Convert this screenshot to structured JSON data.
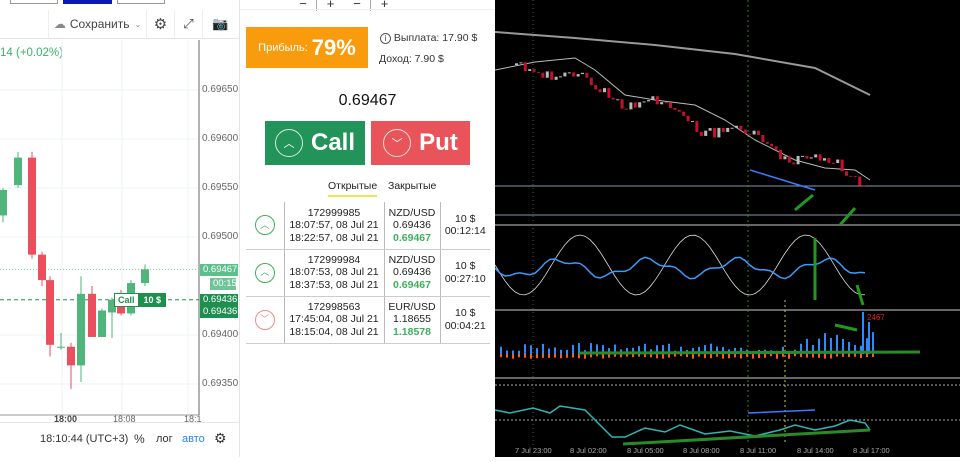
{
  "left_chart": {
    "toolbar": {
      "save_label": "Сохранить"
    },
    "change_text": "14 (+0.02%)",
    "price_ticks": [
      "0.69650",
      "0.69600",
      "0.69550",
      "0.69500",
      "0.69400",
      "0.69350"
    ],
    "time_ticks": [
      "18:00",
      "18:08",
      "18:1"
    ],
    "current_price_tag": "0.69467",
    "countdown_tag": "00:15",
    "open_price_tags": [
      "0.69436",
      "0.69436"
    ],
    "trade_marker": {
      "label": "Call",
      "amount": "10 $"
    },
    "candles": [
      [
        0.69522,
        0.6955,
        0.69515,
        0.69548
      ],
      [
        0.69553,
        0.69587,
        0.6955,
        0.69581
      ],
      [
        0.69581,
        0.69587,
        0.69478,
        0.69482
      ],
      [
        0.69482,
        0.69485,
        0.6945,
        0.69456
      ],
      [
        0.69456,
        0.6946,
        0.69378,
        0.6939
      ],
      [
        0.69388,
        0.69402,
        0.69385,
        0.69388
      ],
      [
        0.69388,
        0.69392,
        0.69345,
        0.69369
      ],
      [
        0.69369,
        0.6946,
        0.69352,
        0.69442
      ],
      [
        0.69442,
        0.6945,
        0.69398,
        0.69398
      ],
      [
        0.69398,
        0.69427,
        0.69398,
        0.69425
      ],
      [
        0.69423,
        0.69438,
        0.69397,
        0.69436
      ],
      [
        0.69436,
        0.69446,
        0.6942,
        0.69422
      ],
      [
        0.69422,
        0.69456,
        0.6942,
        0.69453
      ],
      [
        0.69453,
        0.69472,
        0.6945,
        0.69467
      ]
    ],
    "bottom": {
      "time": "18:10:44 (UTC+3)",
      "percent": "%",
      "log": "лог",
      "auto": "авто"
    }
  },
  "trade_panel": {
    "steppers": [
      "−",
      "+",
      "−",
      "+"
    ],
    "profit_label": "Прибыль:",
    "profit_value": "79%",
    "payout": "Выплата: 17.90 $",
    "income": "Доход: 7.90 $",
    "price": "0.69467",
    "call_label": "Call",
    "put_label": "Put",
    "tabs": [
      "Открытые",
      "Закрытые"
    ],
    "trades": [
      {
        "dir": "up",
        "id": "172999985",
        "open": "18:07:57, 08 Jul 21",
        "close": "18:22:57, 08 Jul 21",
        "pair": "NZD/USD",
        "open_price": "0.69436",
        "cur_price": "0.69467",
        "amount": "10 $",
        "timer": "00:12:14"
      },
      {
        "dir": "up",
        "id": "172999984",
        "open": "18:07:53, 08 Jul 21",
        "close": "18:37:53, 08 Jul 21",
        "pair": "NZD/USD",
        "open_price": "0.69436",
        "cur_price": "0.69467",
        "amount": "10 $",
        "timer": "00:27:10"
      },
      {
        "dir": "down",
        "id": "172998563",
        "open": "17:45:04, 08 Jul 21",
        "close": "18:15:04, 08 Jul 21",
        "pair": "EUR/USD",
        "open_price": "1.18655",
        "cur_price": "1.18578",
        "amount": "10 $",
        "timer": "00:04:21"
      }
    ]
  },
  "mt4_chart": {
    "volume_label": "2467",
    "time_labels": [
      "7 Jul 23:00",
      "8 Jul 02:00",
      "8 Jul 05:00",
      "8 Jul 08:00",
      "8 Jul 11:00",
      "8 Jul 14:00",
      "8 Jul 17:00"
    ]
  },
  "colors": {
    "green": "#22945a",
    "red": "#e9545a",
    "orange": "#f89c0e",
    "up_candle": "#4fb57a",
    "down_candle": "#ea4f5e"
  }
}
